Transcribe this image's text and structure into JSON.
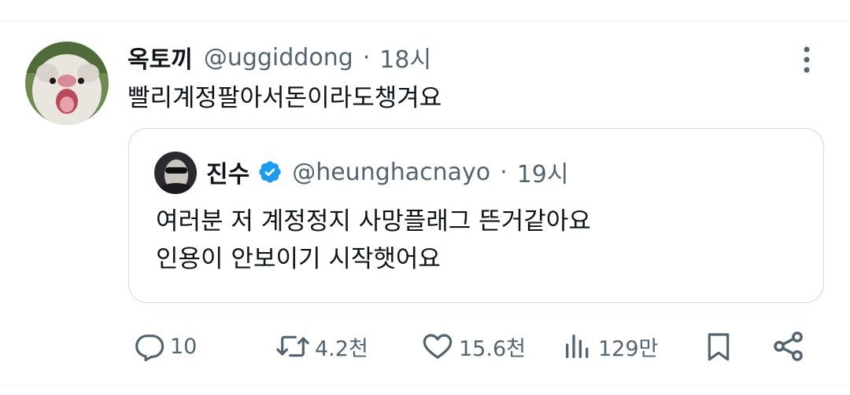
{
  "tweet": {
    "author_name": "옥토끼",
    "handle": "@uggiddong",
    "separator": "·",
    "time": "18시",
    "text": "빨리계정팔아서돈이라도챙겨요"
  },
  "quote": {
    "author_name": "진수",
    "handle": "@heunghacnayo",
    "separator": "·",
    "time": "19시",
    "lines": [
      "여러분 저 계정정지 사망플래그 뜬거같아요",
      "인용이 안보이기 시작햇어요"
    ]
  },
  "actions": {
    "reply_count": "10",
    "retweet_count": "4.2천",
    "like_count": "15.6천",
    "view_count": "129만"
  },
  "icons": {
    "more": "more-vertical-icon",
    "verified": "verified-badge-icon",
    "reply": "reply-icon",
    "retweet": "retweet-icon",
    "like": "heart-icon",
    "views": "views-icon",
    "bookmark": "bookmark-icon",
    "share": "share-icon"
  },
  "colors": {
    "text_primary": "#0f1419",
    "text_secondary": "#536471",
    "verified_blue": "#1d9bf0",
    "border": "#cfd9de"
  }
}
